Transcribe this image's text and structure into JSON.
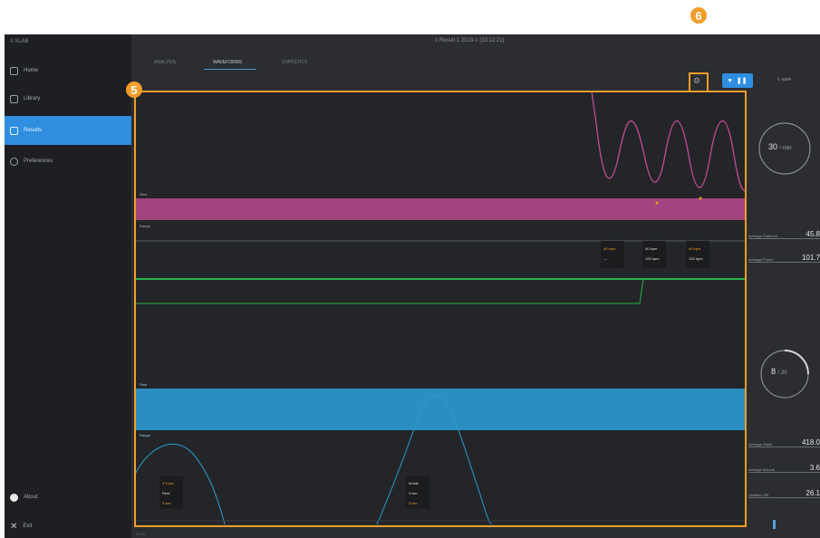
{
  "app": {
    "brand": "≡ XLAB",
    "title": "≡ Result 1  2023-1 (13:12:21)"
  },
  "sidebar": {
    "items": [
      {
        "label": "Home",
        "icon": "home-icon"
      },
      {
        "label": "Library",
        "icon": "library-icon"
      },
      {
        "label": "Results",
        "icon": "results-icon",
        "active": true
      },
      {
        "label": "Preferences",
        "icon": "preferences-icon"
      }
    ],
    "bottom": [
      {
        "label": "About",
        "icon": "info-icon"
      },
      {
        "label": "Exit",
        "icon": "close-icon"
      }
    ]
  },
  "tabs": [
    {
      "label": "ANALYSIS",
      "active": false
    },
    {
      "label": "WAVEFORMS",
      "active": true
    },
    {
      "label": "STATISTICS",
      "active": false
    }
  ],
  "toolbar": {
    "settings_icon": "gear-icon",
    "view_icons": [
      "heart-icon",
      "pause-icon"
    ],
    "export_label": "⇩ save"
  },
  "callouts": {
    "graph": "5",
    "settings": "6"
  },
  "graph": {
    "band_top_label": "Rest",
    "band_top_label2": "Range",
    "band_bottom_label": "Rest",
    "band_bottom_label2": "Range",
    "markers_1": [
      {
        "line1": "40 bpm",
        "line2": "—"
      },
      {
        "line1": "40 bpm",
        "line2": "100 bpm"
      },
      {
        "line1": "40 bpm",
        "line2": "100 bpm"
      }
    ],
    "markers_2": [
      {
        "line1": "0.5 sec",
        "line2": "Rest",
        "line3": "3 sec"
      },
      {
        "line1": "Inhale",
        "line2": "3 sec",
        "line3": "3 sec"
      }
    ],
    "colors": {
      "pink": "#b84a8c",
      "green": "#27b24a",
      "blue": "#2b9bd0",
      "accent": "#f39c2a"
    }
  },
  "rpanel": {
    "ring1": {
      "value": "30",
      "unit": "/ min"
    },
    "ring2": {
      "value": "8",
      "unit": "/ 20"
    },
    "stats": [
      {
        "label": "Average Cadence",
        "value": "45.8"
      },
      {
        "label": "Average Power",
        "value": "101.7"
      },
      {
        "label": "Average Stride",
        "value": "418.0"
      },
      {
        "label": "Average Interval",
        "value": "3.6"
      },
      {
        "label": "Variation HR",
        "value": "26.1"
      }
    ]
  },
  "footer": {
    "label": "00:00"
  }
}
